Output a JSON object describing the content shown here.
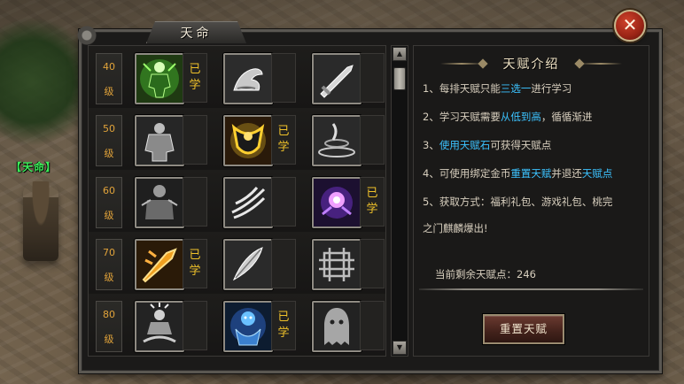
{
  "window": {
    "title": "天命",
    "close_label": "✕"
  },
  "player": {
    "name": "【天命】"
  },
  "levels": [
    {
      "num": "40",
      "unit": "级",
      "slots": [
        {
          "icon": "green-warrior-icon",
          "learned": "已学"
        },
        {
          "icon": "arm-muscle-icon",
          "learned": ""
        },
        {
          "icon": "sword-icon",
          "learned": ""
        }
      ]
    },
    {
      "num": "50",
      "unit": "级",
      "slots": [
        {
          "icon": "armor-figure-icon",
          "learned": ""
        },
        {
          "icon": "golden-shield-icon",
          "learned": "已学"
        },
        {
          "icon": "whirlwind-icon",
          "learned": ""
        }
      ]
    },
    {
      "num": "60",
      "unit": "级",
      "slots": [
        {
          "icon": "shadow-figure-icon",
          "learned": ""
        },
        {
          "icon": "claw-slash-icon",
          "learned": ""
        },
        {
          "icon": "purple-orb-icon",
          "learned": "已学"
        }
      ]
    },
    {
      "num": "70",
      "unit": "级",
      "slots": [
        {
          "icon": "golden-blade-icon",
          "learned": "已学"
        },
        {
          "icon": "feather-blade-icon",
          "learned": ""
        },
        {
          "icon": "knot-icon",
          "learned": ""
        }
      ]
    },
    {
      "num": "80",
      "unit": "级",
      "slots": [
        {
          "icon": "meditating-figure-icon",
          "learned": ""
        },
        {
          "icon": "blue-demon-icon",
          "learned": "已学"
        },
        {
          "icon": "ghost-figure-icon",
          "learned": ""
        }
      ]
    }
  ],
  "intro": {
    "title": "天赋介绍",
    "rules": [
      {
        "a": "1、每排天赋只能",
        "hl": "三选一",
        "b": "进行学习"
      },
      {
        "a": "2、学习天赋需要",
        "hl": "从低到高",
        "b": "，循循渐进"
      },
      {
        "a": "3、",
        "hl": "使用天赋石",
        "b": "可获得天赋点"
      },
      {
        "a": "4、可使用绑定金币",
        "hl": "重置天赋",
        "b": "并退还",
        "hl2": "天赋点"
      },
      {
        "a": "5、获取方式：福利礼包、游戏礼包、桃完",
        "hl": "",
        "b": ""
      },
      {
        "a": "之门麒麟爆出!",
        "hl": "",
        "b": ""
      }
    ],
    "remaining": "当前剩余天赋点：246",
    "reset_label": "重置天赋"
  },
  "scroll": {
    "up": "▲",
    "down": "▼"
  },
  "colors": {
    "accent_gold": "#f0c22a",
    "level_orange": "#e1a33a",
    "highlight_blue": "#3cc3ff"
  }
}
